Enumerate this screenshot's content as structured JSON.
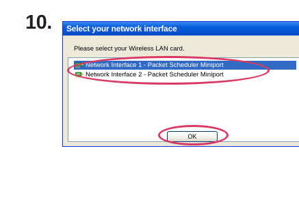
{
  "step": {
    "number": "10."
  },
  "dialog": {
    "title": "Select your network interface",
    "prompt": "Please select your Wireless LAN card.",
    "items": [
      {
        "label": "Network Interface 1 - Packet Scheduler Miniport",
        "icon": "network-adapter-icon",
        "selected": true
      },
      {
        "label": "Network Interface 2 - Packet Scheduler Miniport",
        "icon": "network-adapter-icon",
        "selected": false
      }
    ],
    "ok_label": "OK"
  },
  "colors": {
    "titlebar": "#0654d6",
    "selection": "#316ac5",
    "highlight": "#d93a63",
    "dialog_bg": "#ece9d8"
  }
}
